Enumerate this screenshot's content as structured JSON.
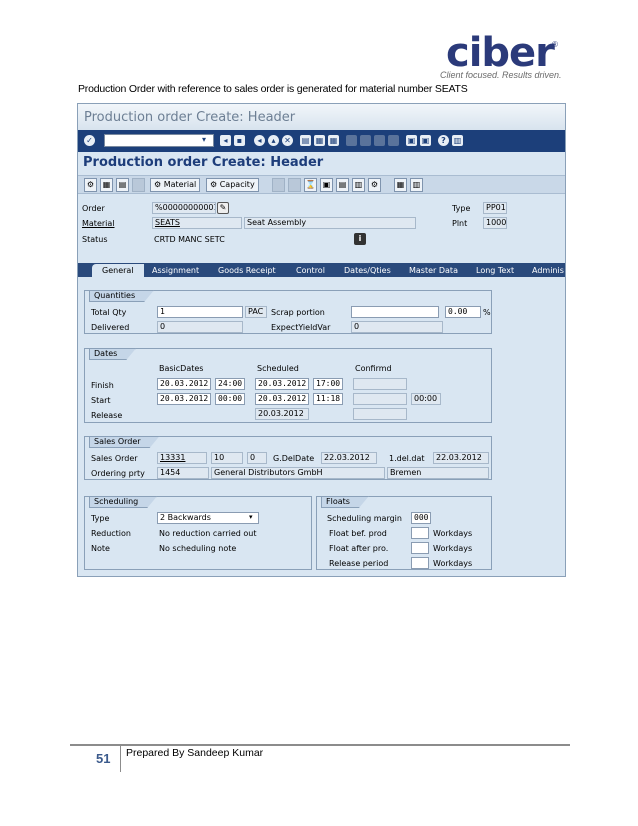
{
  "logo": {
    "word": "ciber",
    "reg": "®",
    "tagline": "Client focused. Results driven."
  },
  "caption": "Production Order with reference to sales order is generated for material number SEATS",
  "sap": {
    "window_title": "Production order Create: Header",
    "screen_title": "Production order Create: Header",
    "toolbar": {
      "material_label": "Material",
      "capacity_label": "Capacity"
    },
    "header": {
      "order_label": "Order",
      "order_value": "%00000000001",
      "material_label": "Material",
      "material_value": "SEATS",
      "material_desc": "Seat Assembly",
      "status_label": "Status",
      "status_value": "CRTD MANC SETC",
      "type_label": "Type",
      "type_value": "PP01",
      "plnt_label": "Plnt",
      "plnt_value": "1000"
    },
    "tabs": [
      "General",
      "Assignment",
      "Goods Receipt",
      "Control",
      "Dates/Qties",
      "Master Data",
      "Long Text",
      "Adminis"
    ],
    "quantities": {
      "title": "Quantities",
      "total_qty_label": "Total Qty",
      "total_qty": "1",
      "unit": "PAC",
      "scrap_label": "Scrap portion",
      "scrap_pct": "0.00",
      "pct_sign": "%",
      "delivered_label": "Delivered",
      "delivered": "0",
      "expect_label": "ExpectYieldVar",
      "expect": "0"
    },
    "dates": {
      "title": "Dates",
      "col_basic": "BasicDates",
      "col_scheduled": "Scheduled",
      "col_confirmed": "Confirmd",
      "finish_label": "Finish",
      "finish_basic_date": "20.03.2012",
      "finish_basic_time": "24:00",
      "finish_sched_date": "20.03.2012",
      "finish_sched_time": "17:00",
      "start_label": "Start",
      "start_basic_date": "20.03.2012",
      "start_basic_time": "00:00",
      "start_sched_date": "20.03.2012",
      "start_sched_time": "11:18",
      "start_conf_time": "00:00",
      "release_label": "Release",
      "release_sched_date": "20.03.2012"
    },
    "sales_order": {
      "title": "Sales Order",
      "so_label": "Sales Order",
      "so_value": "13331",
      "item": "10",
      "sched": "0",
      "gdeldate_label": "G.DelDate",
      "gdeldate": "22.03.2012",
      "deldat_label": "1.del.dat",
      "deldat": "22.03.2012",
      "party_label": "Ordering prty",
      "party_id": "1454",
      "party_name": "General Distributors GmbH",
      "party_city": "Bremen"
    },
    "scheduling": {
      "title": "Scheduling",
      "type_label": "Type",
      "type_value": "2 Backwards",
      "reduction_label": "Reduction",
      "reduction_value": "No reduction carried out",
      "note_label": "Note",
      "note_value": "No scheduling note"
    },
    "floats": {
      "title": "Floats",
      "margin_label": "Scheduling margin",
      "margin_value": "000",
      "bef_label": "Float bef. prod",
      "after_label": "Float after pro.",
      "release_label": "Release period",
      "unit": "Workdays"
    }
  },
  "footer": {
    "page_number": "51",
    "prepared_by": "Prepared By Sandeep Kumar"
  }
}
